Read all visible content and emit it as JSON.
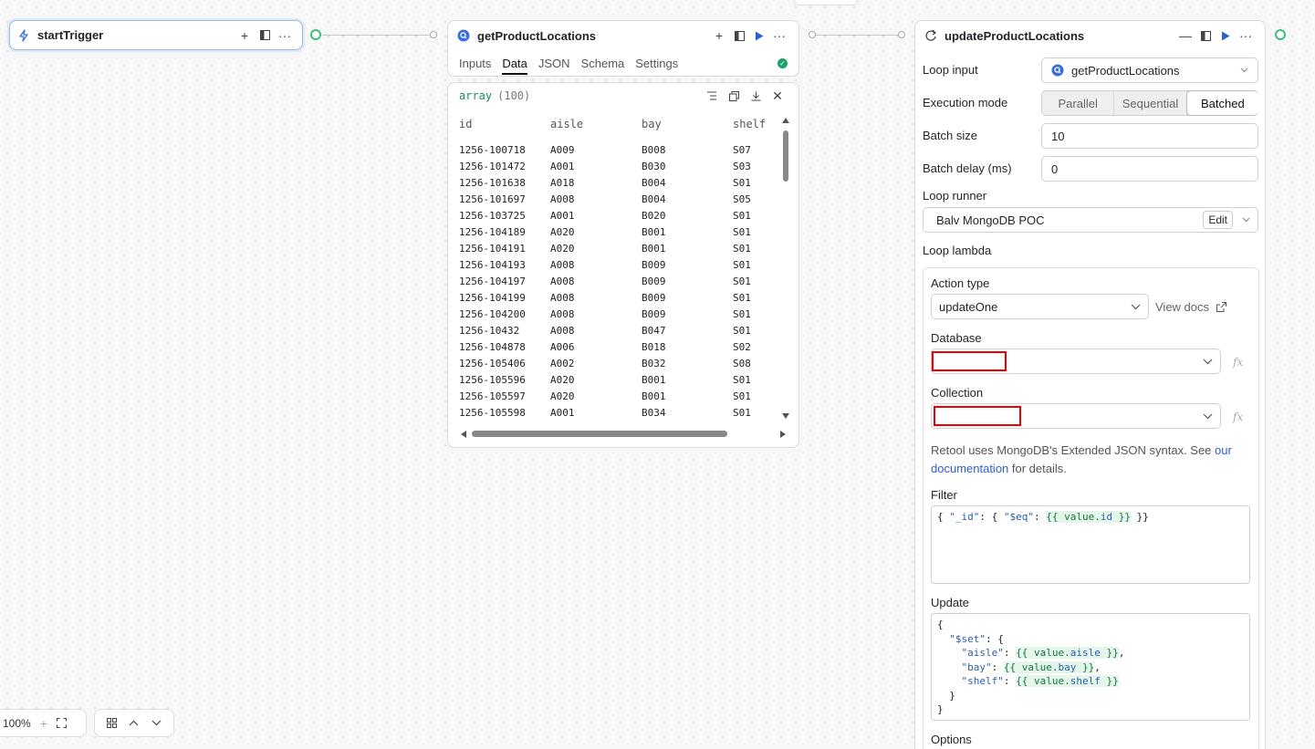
{
  "start_node": {
    "title": "startTrigger"
  },
  "source_node": {
    "title": "getProductLocations",
    "tabs": [
      "Inputs",
      "Data",
      "JSON",
      "Schema",
      "Settings"
    ],
    "active_tab": "Data"
  },
  "data_panel": {
    "type_label": "array",
    "count_label": "(100)",
    "columns": [
      "id",
      "aisle",
      "bay",
      "shelf"
    ],
    "rows": [
      [
        "1256-100718",
        "A009",
        "B008",
        "S07"
      ],
      [
        "1256-101472",
        "A001",
        "B030",
        "S03"
      ],
      [
        "1256-101638",
        "A018",
        "B004",
        "S01"
      ],
      [
        "1256-101697",
        "A008",
        "B004",
        "S05"
      ],
      [
        "1256-103725",
        "A001",
        "B020",
        "S01"
      ],
      [
        "1256-104189",
        "A020",
        "B001",
        "S01"
      ],
      [
        "1256-104191",
        "A020",
        "B001",
        "S01"
      ],
      [
        "1256-104193",
        "A008",
        "B009",
        "S01"
      ],
      [
        "1256-104197",
        "A008",
        "B009",
        "S01"
      ],
      [
        "1256-104199",
        "A008",
        "B009",
        "S01"
      ],
      [
        "1256-104200",
        "A008",
        "B009",
        "S01"
      ],
      [
        "1256-10432",
        "A008",
        "B047",
        "S01"
      ],
      [
        "1256-104878",
        "A006",
        "B018",
        "S02"
      ],
      [
        "1256-105406",
        "A002",
        "B032",
        "S08"
      ],
      [
        "1256-105596",
        "A020",
        "B001",
        "S01"
      ],
      [
        "1256-105597",
        "A020",
        "B001",
        "S01"
      ],
      [
        "1256-105598",
        "A001",
        "B034",
        "S01"
      ]
    ]
  },
  "loop_node": {
    "title": "updateProductLocations",
    "loop_input_label": "Loop input",
    "loop_input_value": "getProductLocations",
    "execution_mode_label": "Execution mode",
    "execution_modes": [
      "Parallel",
      "Sequential",
      "Batched"
    ],
    "execution_mode_selected": "Batched",
    "batch_size_label": "Batch size",
    "batch_size_value": "10",
    "batch_delay_label": "Batch delay (ms)",
    "batch_delay_value": "0",
    "loop_runner_label": "Loop runner",
    "loop_runner_value": "Balv MongoDB POC",
    "edit_label": "Edit",
    "loop_lambda_label": "Loop lambda",
    "action_type_label": "Action type",
    "action_type_value": "updateOne",
    "view_docs_label": "View docs",
    "database_label": "Database",
    "collection_label": "Collection",
    "fx_label": "fx",
    "note_prefix": "Retool uses MongoDB's Extended JSON syntax. See ",
    "note_link_1": "our",
    "note_link_2": "documentation",
    "note_suffix": " for details.",
    "filter_label": "Filter",
    "update_label": "Update",
    "options_label": "Options"
  },
  "zoom": {
    "level": "100%"
  }
}
